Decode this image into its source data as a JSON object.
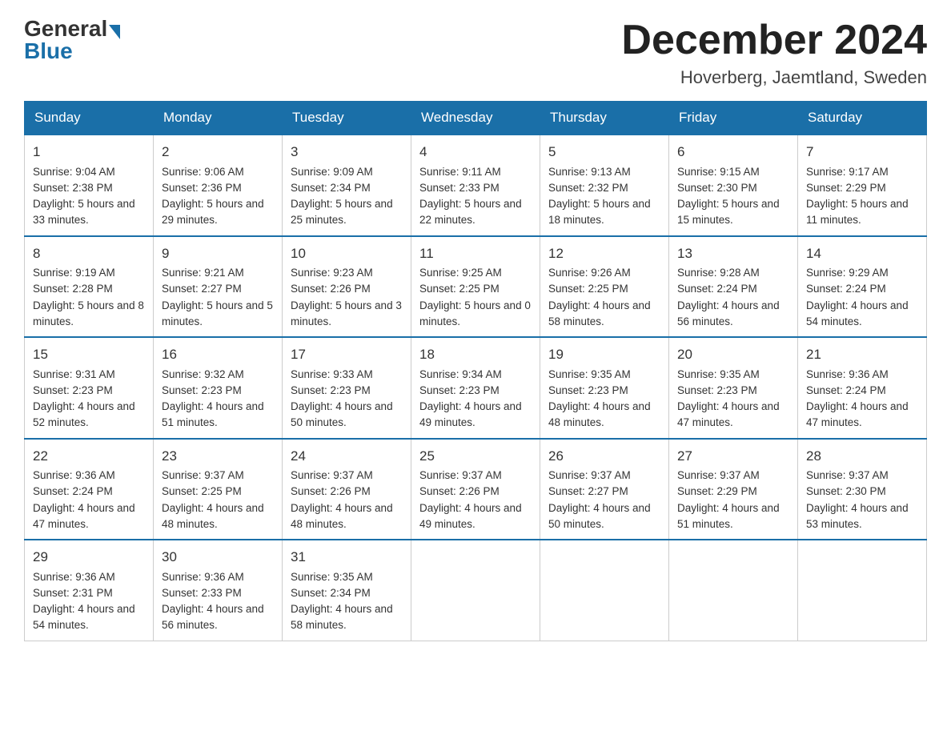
{
  "header": {
    "logo_general": "General",
    "logo_blue": "Blue",
    "month_title": "December 2024",
    "location": "Hoverberg, Jaemtland, Sweden"
  },
  "days_of_week": [
    "Sunday",
    "Monday",
    "Tuesday",
    "Wednesday",
    "Thursday",
    "Friday",
    "Saturday"
  ],
  "weeks": [
    [
      {
        "day": "1",
        "sunrise": "9:04 AM",
        "sunset": "2:38 PM",
        "daylight": "5 hours and 33 minutes."
      },
      {
        "day": "2",
        "sunrise": "9:06 AM",
        "sunset": "2:36 PM",
        "daylight": "5 hours and 29 minutes."
      },
      {
        "day": "3",
        "sunrise": "9:09 AM",
        "sunset": "2:34 PM",
        "daylight": "5 hours and 25 minutes."
      },
      {
        "day": "4",
        "sunrise": "9:11 AM",
        "sunset": "2:33 PM",
        "daylight": "5 hours and 22 minutes."
      },
      {
        "day": "5",
        "sunrise": "9:13 AM",
        "sunset": "2:32 PM",
        "daylight": "5 hours and 18 minutes."
      },
      {
        "day": "6",
        "sunrise": "9:15 AM",
        "sunset": "2:30 PM",
        "daylight": "5 hours and 15 minutes."
      },
      {
        "day": "7",
        "sunrise": "9:17 AM",
        "sunset": "2:29 PM",
        "daylight": "5 hours and 11 minutes."
      }
    ],
    [
      {
        "day": "8",
        "sunrise": "9:19 AM",
        "sunset": "2:28 PM",
        "daylight": "5 hours and 8 minutes."
      },
      {
        "day": "9",
        "sunrise": "9:21 AM",
        "sunset": "2:27 PM",
        "daylight": "5 hours and 5 minutes."
      },
      {
        "day": "10",
        "sunrise": "9:23 AM",
        "sunset": "2:26 PM",
        "daylight": "5 hours and 3 minutes."
      },
      {
        "day": "11",
        "sunrise": "9:25 AM",
        "sunset": "2:25 PM",
        "daylight": "5 hours and 0 minutes."
      },
      {
        "day": "12",
        "sunrise": "9:26 AM",
        "sunset": "2:25 PM",
        "daylight": "4 hours and 58 minutes."
      },
      {
        "day": "13",
        "sunrise": "9:28 AM",
        "sunset": "2:24 PM",
        "daylight": "4 hours and 56 minutes."
      },
      {
        "day": "14",
        "sunrise": "9:29 AM",
        "sunset": "2:24 PM",
        "daylight": "4 hours and 54 minutes."
      }
    ],
    [
      {
        "day": "15",
        "sunrise": "9:31 AM",
        "sunset": "2:23 PM",
        "daylight": "4 hours and 52 minutes."
      },
      {
        "day": "16",
        "sunrise": "9:32 AM",
        "sunset": "2:23 PM",
        "daylight": "4 hours and 51 minutes."
      },
      {
        "day": "17",
        "sunrise": "9:33 AM",
        "sunset": "2:23 PM",
        "daylight": "4 hours and 50 minutes."
      },
      {
        "day": "18",
        "sunrise": "9:34 AM",
        "sunset": "2:23 PM",
        "daylight": "4 hours and 49 minutes."
      },
      {
        "day": "19",
        "sunrise": "9:35 AM",
        "sunset": "2:23 PM",
        "daylight": "4 hours and 48 minutes."
      },
      {
        "day": "20",
        "sunrise": "9:35 AM",
        "sunset": "2:23 PM",
        "daylight": "4 hours and 47 minutes."
      },
      {
        "day": "21",
        "sunrise": "9:36 AM",
        "sunset": "2:24 PM",
        "daylight": "4 hours and 47 minutes."
      }
    ],
    [
      {
        "day": "22",
        "sunrise": "9:36 AM",
        "sunset": "2:24 PM",
        "daylight": "4 hours and 47 minutes."
      },
      {
        "day": "23",
        "sunrise": "9:37 AM",
        "sunset": "2:25 PM",
        "daylight": "4 hours and 48 minutes."
      },
      {
        "day": "24",
        "sunrise": "9:37 AM",
        "sunset": "2:26 PM",
        "daylight": "4 hours and 48 minutes."
      },
      {
        "day": "25",
        "sunrise": "9:37 AM",
        "sunset": "2:26 PM",
        "daylight": "4 hours and 49 minutes."
      },
      {
        "day": "26",
        "sunrise": "9:37 AM",
        "sunset": "2:27 PM",
        "daylight": "4 hours and 50 minutes."
      },
      {
        "day": "27",
        "sunrise": "9:37 AM",
        "sunset": "2:29 PM",
        "daylight": "4 hours and 51 minutes."
      },
      {
        "day": "28",
        "sunrise": "9:37 AM",
        "sunset": "2:30 PM",
        "daylight": "4 hours and 53 minutes."
      }
    ],
    [
      {
        "day": "29",
        "sunrise": "9:36 AM",
        "sunset": "2:31 PM",
        "daylight": "4 hours and 54 minutes."
      },
      {
        "day": "30",
        "sunrise": "9:36 AM",
        "sunset": "2:33 PM",
        "daylight": "4 hours and 56 minutes."
      },
      {
        "day": "31",
        "sunrise": "9:35 AM",
        "sunset": "2:34 PM",
        "daylight": "4 hours and 58 minutes."
      },
      null,
      null,
      null,
      null
    ]
  ],
  "labels": {
    "sunrise_prefix": "Sunrise: ",
    "sunset_prefix": "Sunset: ",
    "daylight_prefix": "Daylight: "
  }
}
